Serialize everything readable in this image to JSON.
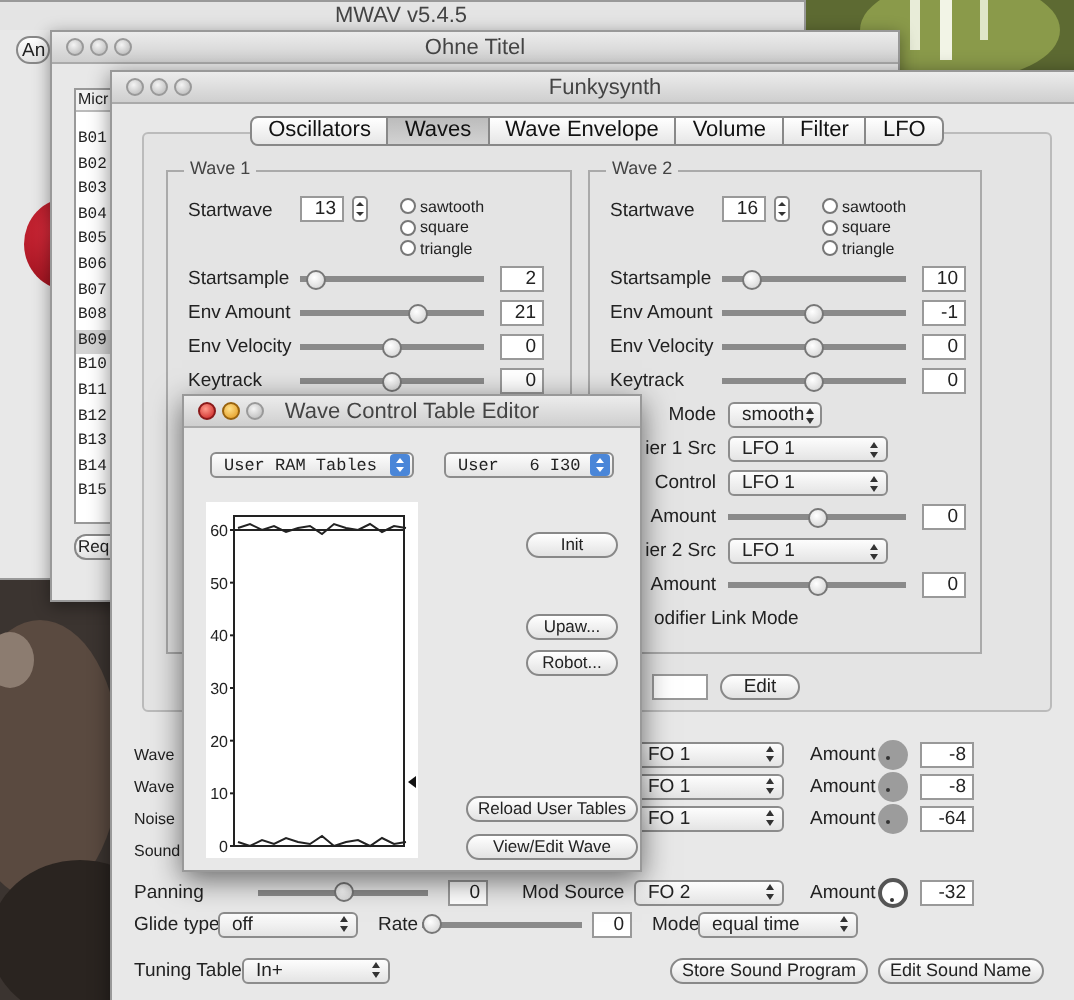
{
  "mwav": {
    "title": "MWAV v5.4.5",
    "button": "An"
  },
  "ohne_titel": {
    "title": "Ohne Titel",
    "list_header": "Micr",
    "list_items": [
      {
        "label": "B01",
        "selected": false
      },
      {
        "label": "B02",
        "selected": false
      },
      {
        "label": "B03",
        "selected": false
      },
      {
        "label": "B04",
        "selected": false
      },
      {
        "label": "B05",
        "selected": false
      },
      {
        "label": "B06",
        "selected": false
      },
      {
        "label": "B07",
        "selected": false
      },
      {
        "label": "B08",
        "selected": false
      },
      {
        "label": "B09",
        "selected": true
      },
      {
        "label": "B10",
        "selected": false
      },
      {
        "label": "B11",
        "selected": false
      },
      {
        "label": "B12",
        "selected": false
      },
      {
        "label": "B13",
        "selected": false
      },
      {
        "label": "B14",
        "selected": false
      },
      {
        "label": "B15",
        "selected": false
      }
    ],
    "button": "Req"
  },
  "funkysynth": {
    "title": "Funkysynth",
    "tabs": [
      {
        "label": "Oscillators",
        "selected": false
      },
      {
        "label": "Waves",
        "selected": true
      },
      {
        "label": "Wave Envelope",
        "selected": false
      },
      {
        "label": "Volume",
        "selected": false
      },
      {
        "label": "Filter",
        "selected": false
      },
      {
        "label": "LFO",
        "selected": false
      }
    ],
    "wave_groups": [
      {
        "title": "Wave 1",
        "startwave_label": "Startwave",
        "startwave": "13",
        "radios": [
          {
            "label": "sawtooth",
            "selected": false
          },
          {
            "label": "square",
            "selected": false
          },
          {
            "label": "triangle",
            "selected": false
          }
        ],
        "sliders": [
          {
            "label": "Startsample",
            "level": 0.04,
            "value": "2"
          },
          {
            "label": "Env Amount",
            "level": 0.66,
            "value": "21"
          },
          {
            "label": "Env Velocity",
            "level": 0.5,
            "value": "0"
          },
          {
            "label": "Keytrack",
            "level": 0.5,
            "value": "0"
          }
        ]
      },
      {
        "title": "Wave 2",
        "startwave_label": "Startwave",
        "startwave": "16",
        "radios": [
          {
            "label": "sawtooth",
            "selected": false
          },
          {
            "label": "square",
            "selected": false
          },
          {
            "label": "triangle",
            "selected": false
          }
        ],
        "sliders": [
          {
            "label": "Startsample",
            "level": 0.12,
            "value": "10"
          },
          {
            "label": "Env Amount",
            "level": 0.5,
            "value": "-1"
          },
          {
            "label": "Env Velocity",
            "level": 0.5,
            "value": "0"
          },
          {
            "label": "Keytrack",
            "level": 0.5,
            "value": "0"
          }
        ],
        "extra_rows": [
          {
            "kind": "select",
            "label": "Mode",
            "value": "smooth"
          },
          {
            "kind": "select",
            "label": "ier 1 Src",
            "value": "LFO 1"
          },
          {
            "kind": "select",
            "label": "Control",
            "value": "LFO 1"
          },
          {
            "kind": "slider",
            "label": "Amount",
            "level": 0.5,
            "value": "0"
          },
          {
            "kind": "select",
            "label": "ier 2 Src",
            "value": "LFO 1"
          },
          {
            "kind": "slider",
            "label": "Amount",
            "level": 0.5,
            "value": "0"
          },
          {
            "kind": "text",
            "label": "odifier Link Mode"
          }
        ]
      }
    ],
    "edit_button": "Edit",
    "mod_rows": [
      {
        "kind": "mod",
        "label": "Wave",
        "source": "FO 1",
        "amount_label": "Amount",
        "disabled": true,
        "amount": "-8"
      },
      {
        "kind": "mod",
        "label": "Wave",
        "source": "FO 1",
        "amount_label": "Amount",
        "disabled": true,
        "amount": "-8"
      },
      {
        "kind": "mod",
        "label": "Noise",
        "source": "FO 1",
        "amount_label": "Amount",
        "disabled": true,
        "amount": "-64"
      },
      {
        "kind": "label",
        "label": "Sound"
      },
      {
        "kind": "pan",
        "label": "Panning",
        "level": 0.5,
        "value": "0",
        "source_label": "Mod Source",
        "source": "FO 2",
        "amount_label": "Amount",
        "disabled": false,
        "amount": "-32"
      }
    ],
    "glide": {
      "label": "Glide type",
      "value": "off",
      "rate": {
        "label": "Rate",
        "level": 0,
        "value": "0"
      },
      "mode_label": "Mode",
      "mode_value": "equal time"
    },
    "tuning": {
      "label": "Tuning Table",
      "value": "In+"
    },
    "buttons": [
      "Store Sound Program",
      "Edit Sound Name"
    ]
  },
  "editor": {
    "title": "Wave Control Table Editor",
    "table_select": "User RAM Tables",
    "wave_select": "User   6 I30",
    "y_ticks": [
      "60",
      "50",
      "40",
      "30",
      "20",
      "10",
      "0"
    ],
    "buttons": [
      "Init",
      "Upaw...",
      "Robot...",
      "Reload User Tables",
      "View/Edit Wave"
    ]
  }
}
